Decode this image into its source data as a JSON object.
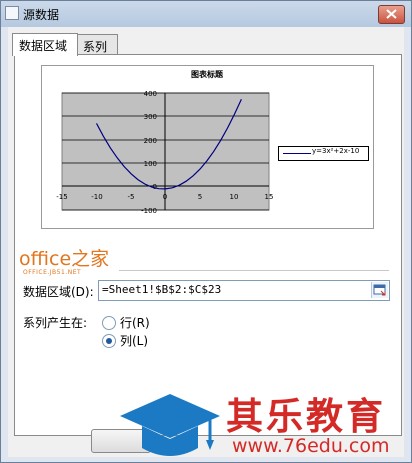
{
  "window": {
    "title": "源数据",
    "close_label": "×"
  },
  "tabs": [
    {
      "label": "数据区域",
      "active": true
    },
    {
      "label": "系列",
      "active": false
    }
  ],
  "chart": {
    "title": "图表标题",
    "legend": "y=3x²+2x-10",
    "y_ticks": [
      "400",
      "300",
      "200",
      "100",
      "0",
      "-100"
    ],
    "x_ticks": [
      "-15",
      "-10",
      "-5",
      "0",
      "5",
      "10",
      "15"
    ]
  },
  "chart_data": {
    "type": "line",
    "title": "图表标题",
    "xlabel": "",
    "ylabel": "",
    "xlim": [
      -15,
      15
    ],
    "ylim": [
      -100,
      400
    ],
    "grid": true,
    "legend_position": "right",
    "series": [
      {
        "name": "y=3x²+2x-10",
        "color": "#000080",
        "x": [
          -10,
          -9,
          -8,
          -7,
          -6,
          -5,
          -4,
          -3,
          -2,
          -1,
          0,
          1,
          2,
          3,
          4,
          5,
          6,
          7,
          8,
          9,
          10,
          11
        ],
        "y": [
          270,
          215,
          166,
          123,
          86,
          55,
          30,
          11,
          -2,
          -9,
          -10,
          -5,
          6,
          23,
          46,
          75,
          110,
          151,
          198,
          251,
          310,
          373
        ]
      }
    ]
  },
  "watermark_top": {
    "brand": "office之家",
    "url": "OFFICE.JB51.NET"
  },
  "data_range": {
    "label": "数据区域(D):",
    "value": "=Sheet1!$B$2:$C$23"
  },
  "series_in": {
    "label": "系列产生在:",
    "options": [
      {
        "label": "行(R)",
        "selected": false
      },
      {
        "label": "列(L)",
        "selected": true
      }
    ]
  },
  "watermark_bottom": {
    "brand": "其乐教育",
    "url": "www.76edu.com",
    "colors": {
      "red": "#d42a27",
      "blue": "#1c7ac4"
    }
  }
}
